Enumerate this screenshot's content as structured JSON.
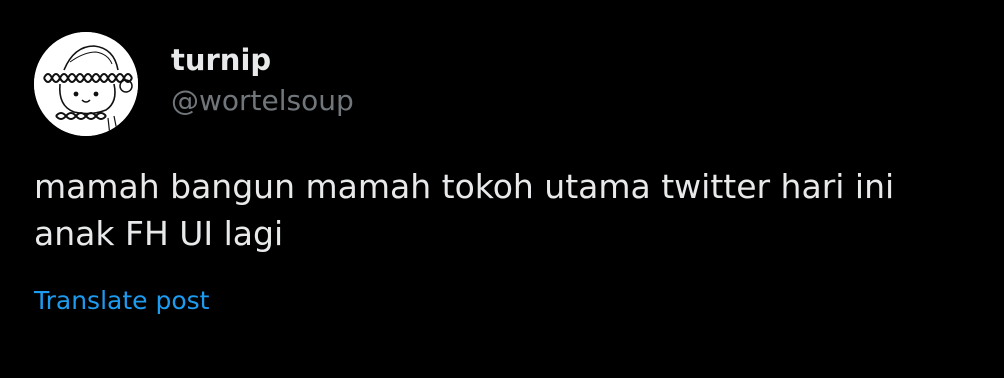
{
  "author": {
    "display_name": "turnip",
    "handle": "@wortelsoup",
    "avatar_icon": "doodle-avatar-icon"
  },
  "post": {
    "text_lines": [
      "mamah bangun mamah tokoh utama twitter hari ini",
      "anak FH UI lagi"
    ]
  },
  "actions": {
    "translate_label": "Translate post"
  },
  "colors": {
    "background": "#000000",
    "primary_text": "#e7e9ea",
    "secondary_text": "#71767b",
    "link": "#1d9bf0"
  }
}
